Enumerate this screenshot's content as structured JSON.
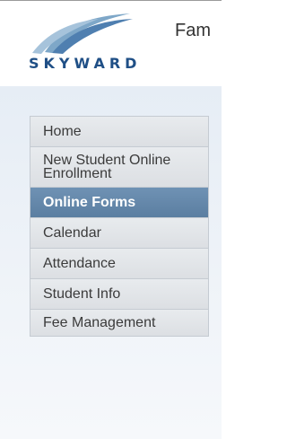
{
  "header": {
    "logo_text": "SKYWARD",
    "logo_mark": "®",
    "title": "Fam"
  },
  "nav": {
    "items": [
      {
        "label": "Home"
      },
      {
        "label": "New Student Online Enrollment"
      },
      {
        "label": "Online Forms",
        "active": true
      },
      {
        "label": "Calendar"
      },
      {
        "label": "Attendance"
      },
      {
        "label": "Student Info"
      },
      {
        "label": "Fee Management"
      }
    ]
  },
  "colors": {
    "active_bg": "#5f83a7",
    "brand": "#1f4f86"
  }
}
